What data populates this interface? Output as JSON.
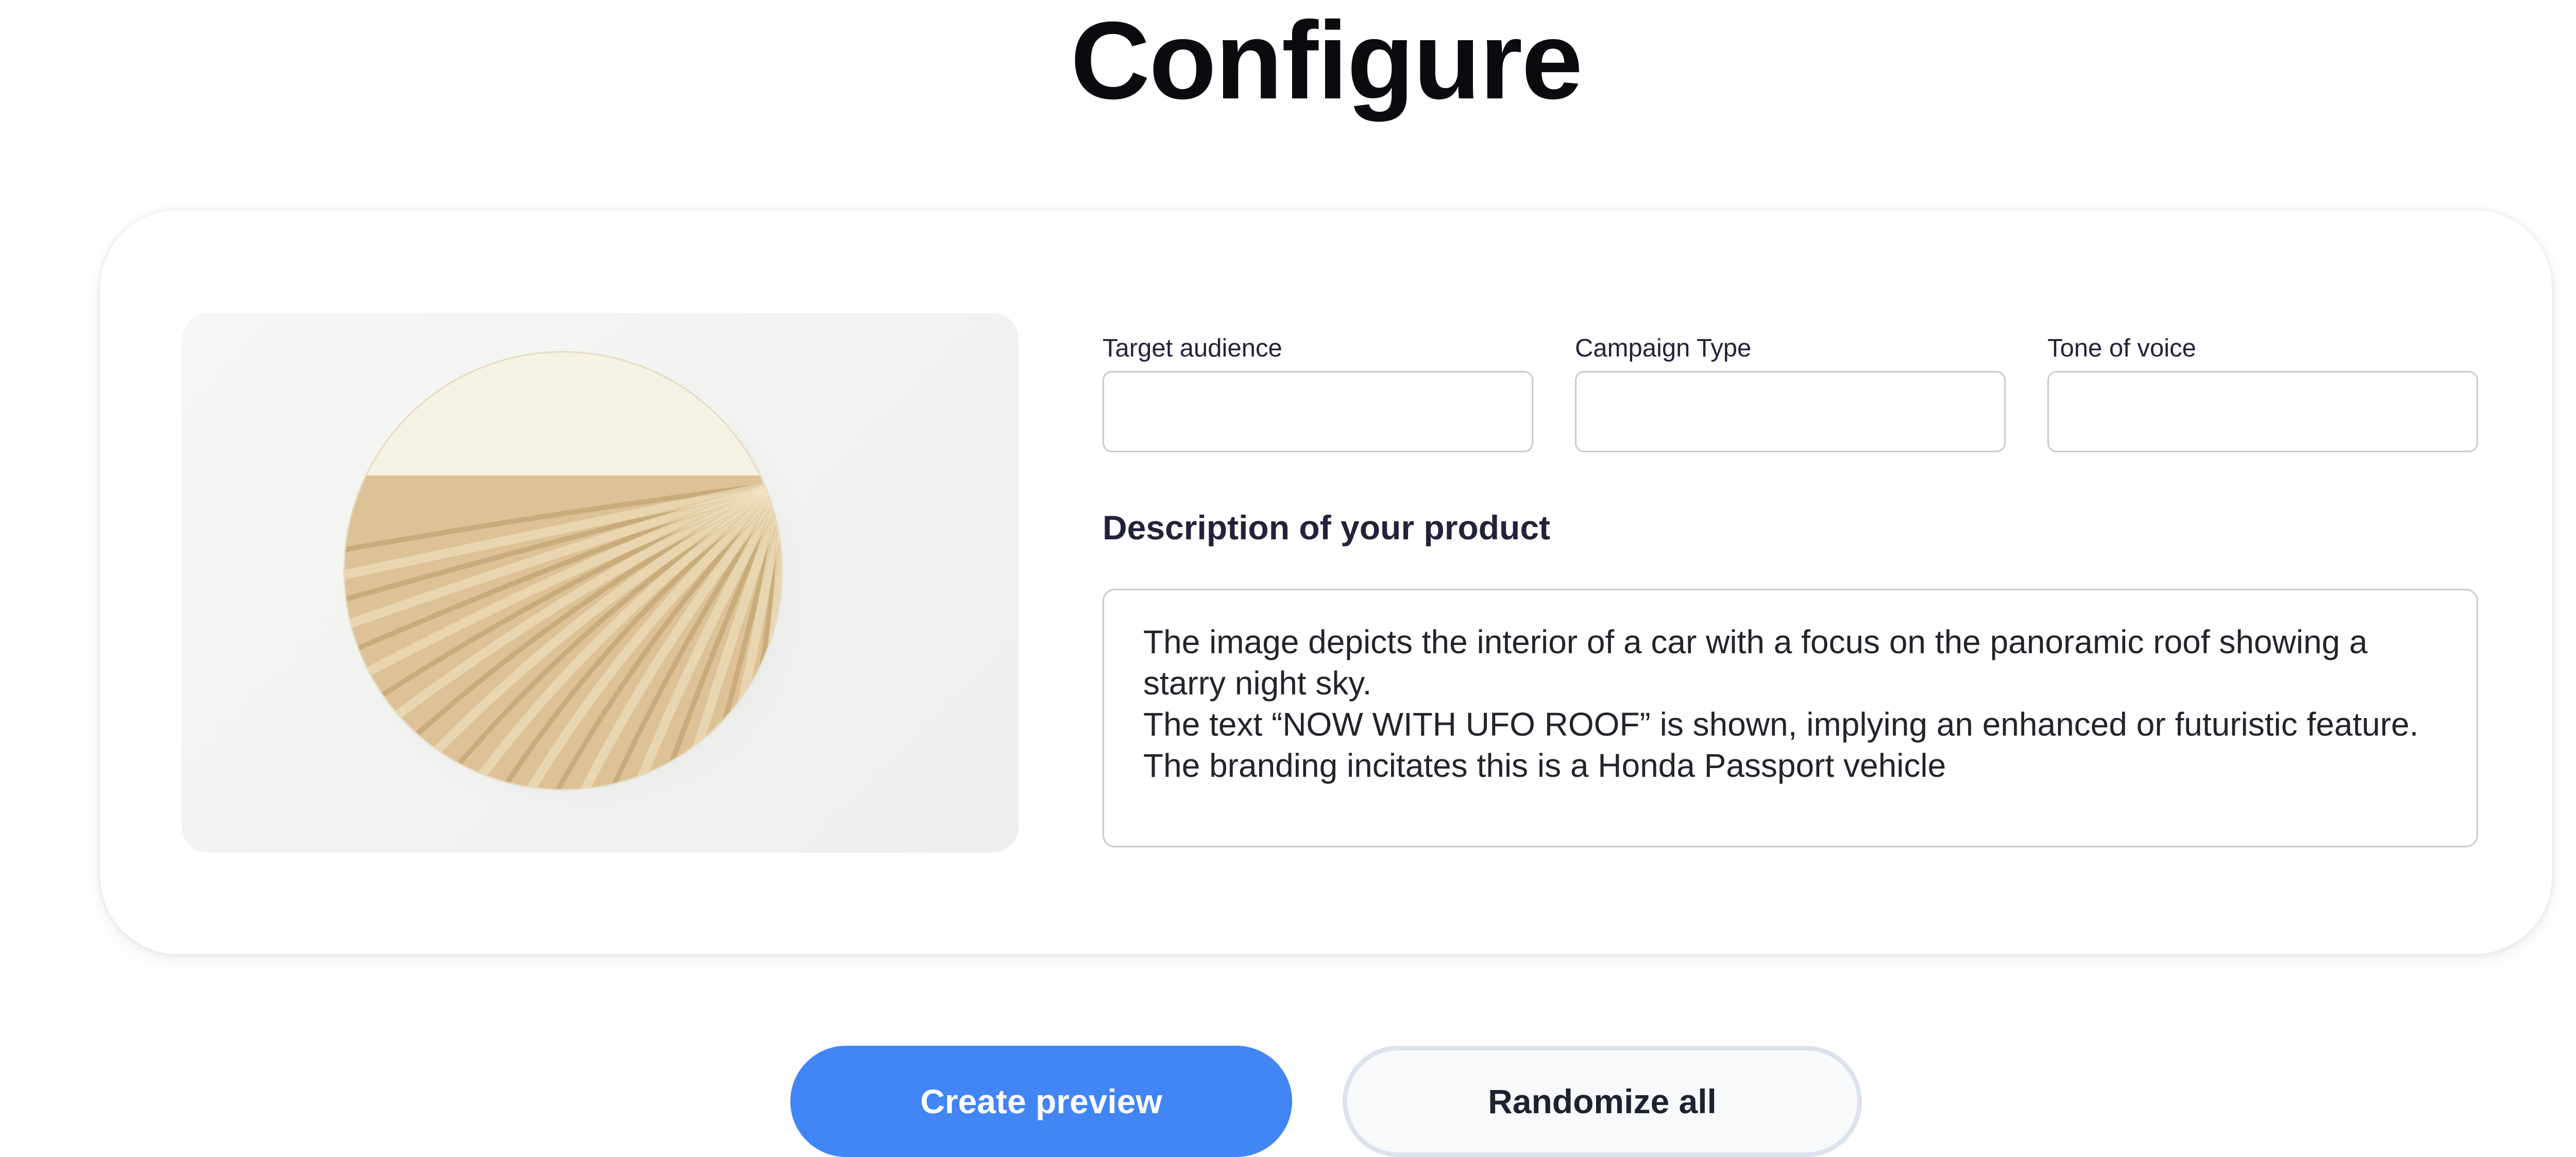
{
  "page": {
    "title": "Configure"
  },
  "config_form": {
    "target_audience": {
      "label": "Target audience",
      "value": ""
    },
    "campaign_type": {
      "label": "Campaign Type",
      "value": ""
    },
    "tone_of_voice": {
      "label": "Tone of voice",
      "value": ""
    },
    "description": {
      "heading": "Description of your product",
      "value": "The image depicts the interior of a car with a focus on the panoramic roof showing a starry night sky.\nThe text “NOW WITH UFO ROOF” is shown, implying an enhanced or futuristic feature.\nThe branding incitates this is a Honda Passport vehicle"
    }
  },
  "actions": {
    "create_preview_label": "Create preview",
    "randomize_all_label": "Randomize all"
  },
  "colors": {
    "primary_button": "#4285f4",
    "secondary_button_border": "#dde3ec",
    "input_border": "#c9cace",
    "product_beige": "#d8bd8c",
    "product_cream": "#f6f2e3"
  }
}
